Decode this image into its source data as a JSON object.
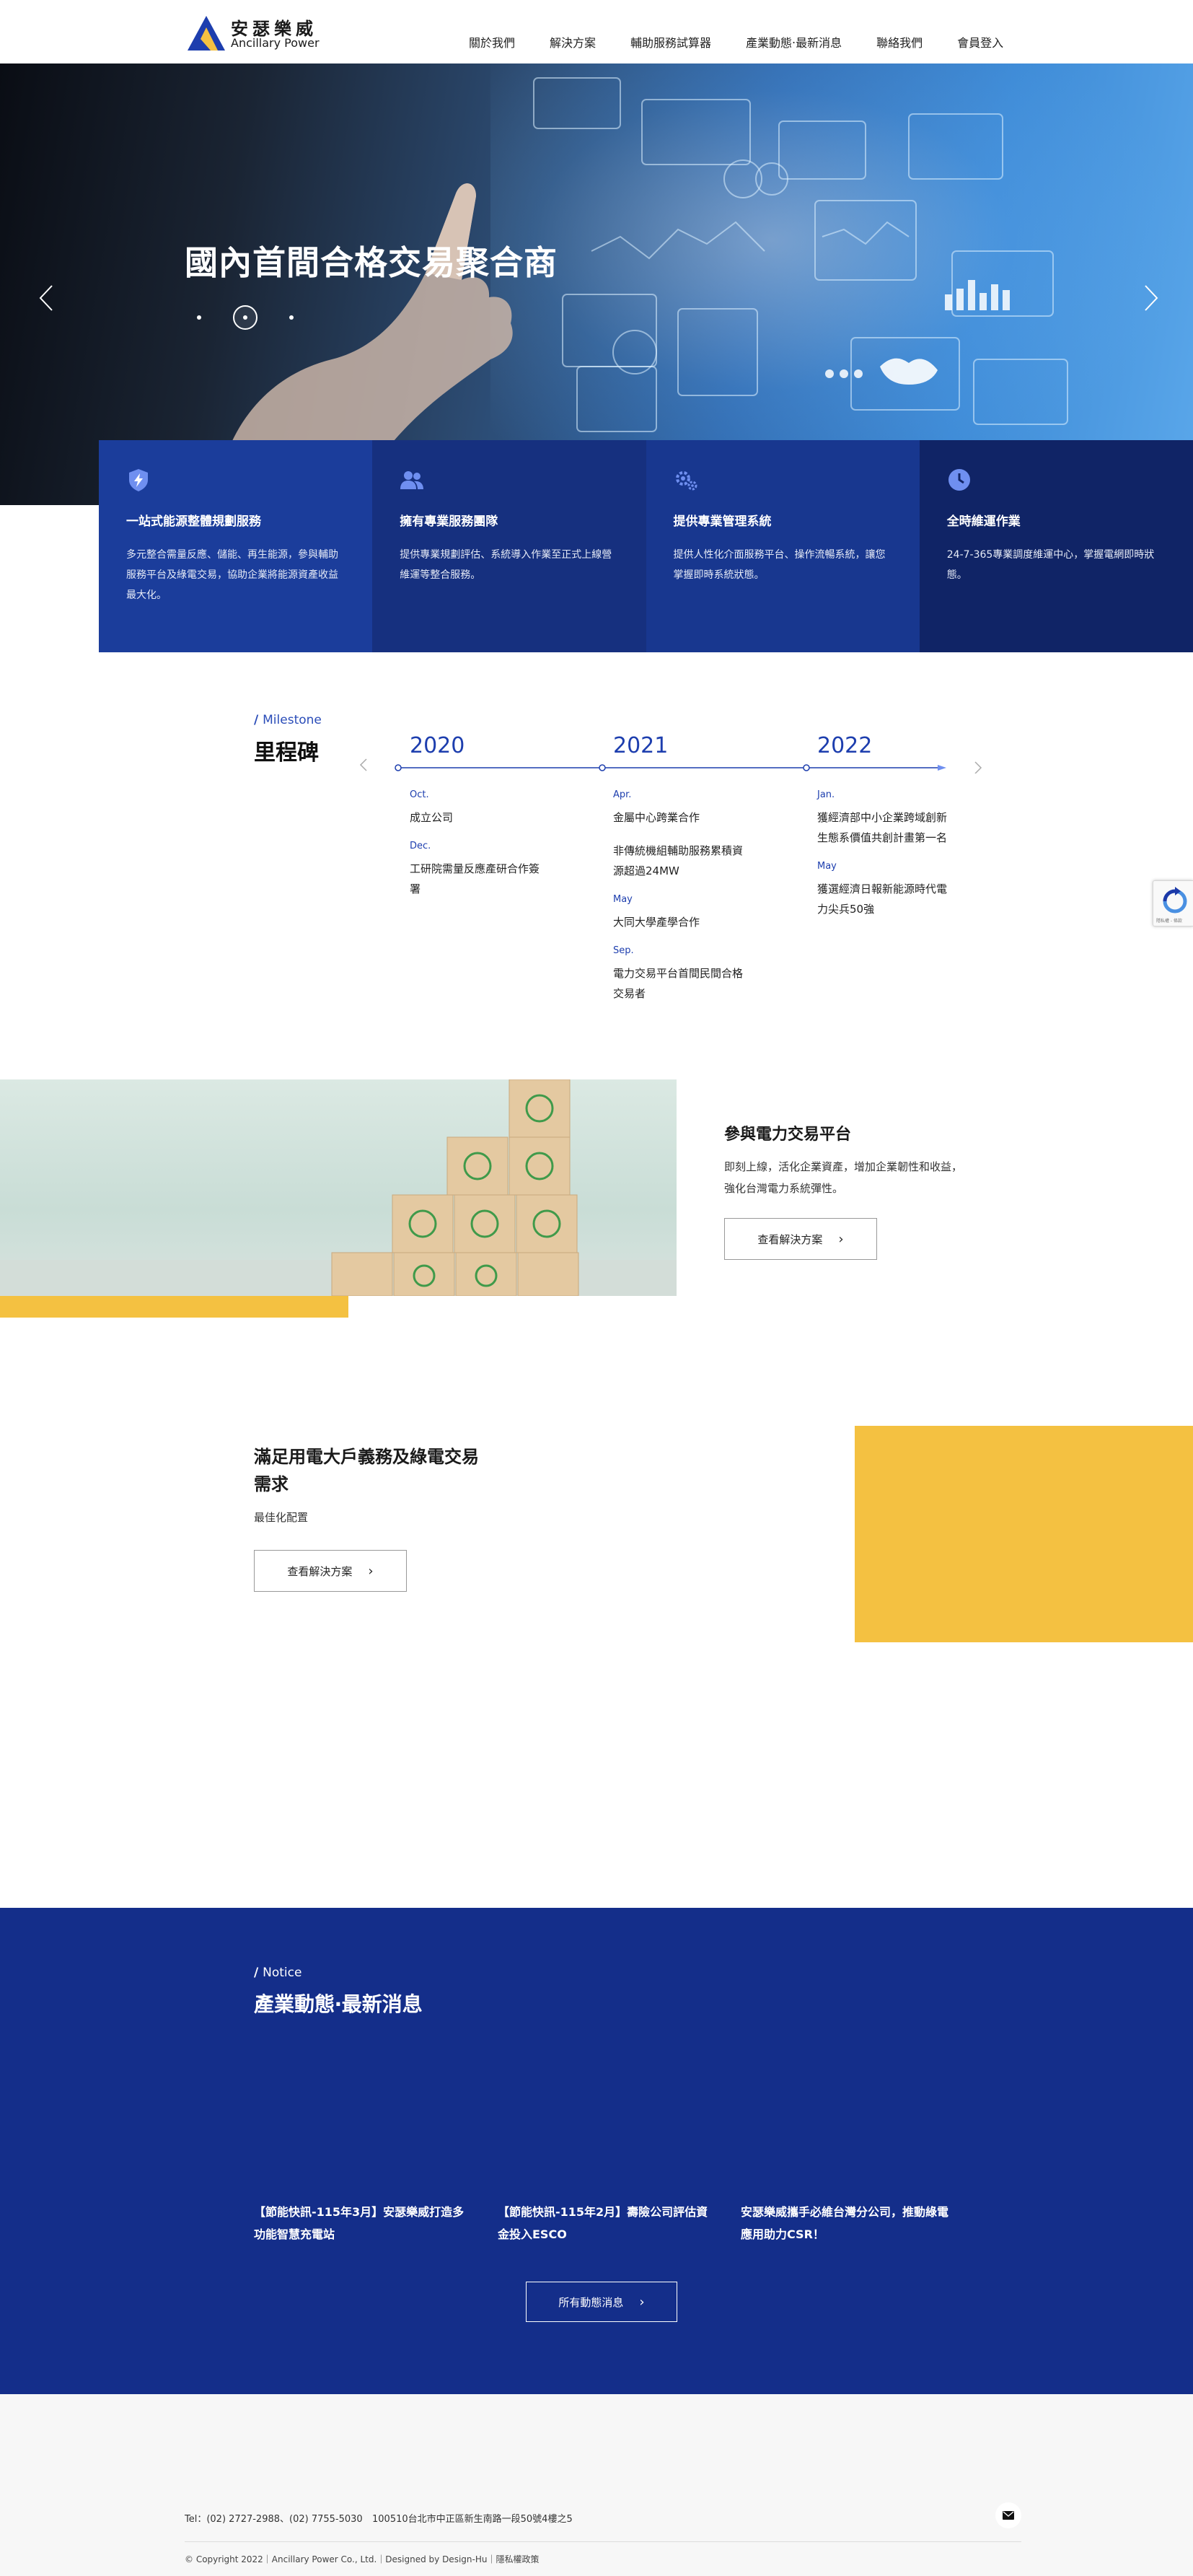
{
  "brand": {
    "name_cn": "安瑟樂威",
    "name_en": "Ancillary Power"
  },
  "nav": {
    "items": [
      "關於我們",
      "解決方案",
      "輔助服務試算器",
      "產業動態‧最新消息",
      "聯絡我們",
      "會員登入"
    ]
  },
  "hero": {
    "title": "國內首間合格交易聚合商",
    "slides_total": 3,
    "slide_active": 2
  },
  "features": [
    {
      "icon": "bolt-shield-icon",
      "title": "一站式能源整體規劃服務",
      "desc": "多元整合需量反應、儲能、再生能源，參與輔助服務平台及綠電交易，協助企業將能源資產收益最大化。"
    },
    {
      "icon": "team-icon",
      "title": "擁有專業服務團隊",
      "desc": "提供專業規劃評估、系統導入作業至正式上線營維運等整合服務。"
    },
    {
      "icon": "gears-icon",
      "title": "提供專業管理系統",
      "desc": "提供人性化介面服務平台、操作流暢系統，讓您掌握即時系統狀態。"
    },
    {
      "icon": "clock-icon",
      "title": "全時維運作業",
      "desc": "24-7-365專業調度維運中心，掌握電網即時狀態。"
    }
  ],
  "milestone": {
    "tag": "Milestone",
    "title": "里程碑",
    "years": [
      {
        "year": "2020",
        "entries": [
          {
            "month": "Oct.",
            "events": [
              "成立公司"
            ]
          },
          {
            "month": "Dec.",
            "events": [
              "工研院需量反應產研合作簽署"
            ]
          }
        ]
      },
      {
        "year": "2021",
        "entries": [
          {
            "month": "Apr.",
            "events": [
              "金屬中心跨業合作",
              "非傳統機組輔助服務累積資源超過24MW"
            ]
          },
          {
            "month": "May",
            "events": [
              "大同大學產學合作"
            ]
          },
          {
            "month": "Sep.",
            "events": [
              "電力交易平台首間民間合格交易者"
            ]
          }
        ]
      },
      {
        "year": "2022",
        "entries": [
          {
            "month": "Jan.",
            "events": [
              "獲經濟部中小企業跨域創新生態系價值共創計畫第一名"
            ]
          },
          {
            "month": "May",
            "events": [
              "獲選經濟日報新能源時代電力尖兵50強"
            ]
          }
        ]
      }
    ]
  },
  "platform": {
    "title": "參與電力交易平台",
    "desc": "即刻上線，活化企業資產，增加企業韌性和收益，強化台灣電力系統彈性。",
    "button": "查看解決方案"
  },
  "demand": {
    "title": "滿足用電大戶義務及綠電交易需求",
    "subtitle": "最佳化配置",
    "button": "查看解決方案"
  },
  "notice": {
    "tag": "Notice",
    "title": "產業動態‧最新消息",
    "items": [
      "【節能快訊-115年3月】安瑟樂威打造多功能智慧充電站",
      "【節能快訊-115年2月】壽險公司評估資金投入ESCO",
      "安瑟樂威攜手必維台灣分公司，推動綠電應用助力CSR！"
    ],
    "button": "所有動態消息"
  },
  "footer": {
    "tel": "Tel：(02) 2727-2988、(02) 7755-5030",
    "address": "100510台北市中正區新生南路一段50號4樓之5",
    "copyright": "© Copyright 2022｜Ancillary Power Co., Ltd.｜Designed by Design-Hu｜",
    "privacy": "隱私權政策"
  },
  "colors": {
    "feature_1": "#1b3d9b",
    "feature_2": "#16307f",
    "feature_3": "#18378f",
    "feature_4": "#102466",
    "brand_blue": "#1d3eae",
    "accent_yellow": "#f4c141",
    "notice_bg": "#142e8a"
  },
  "recaptcha": {
    "text": "隱私權 - 條款"
  }
}
